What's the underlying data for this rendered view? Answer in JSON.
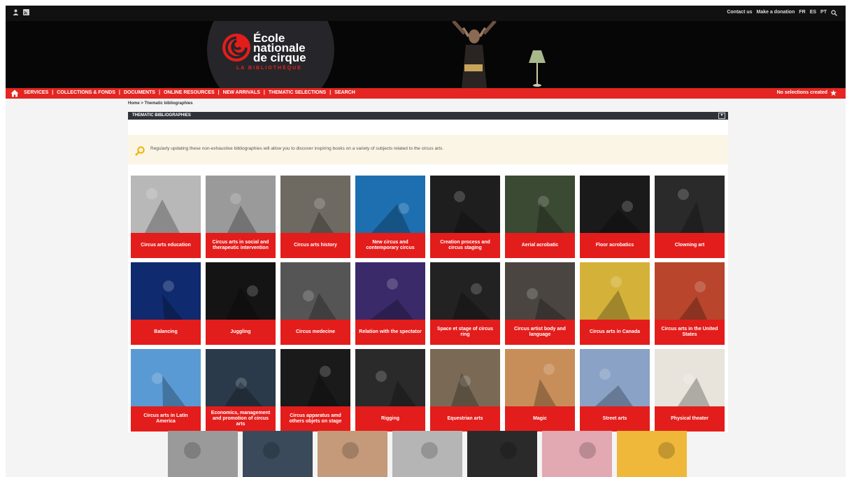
{
  "topbar": {
    "user_icon": "user-icon",
    "rss_icon": "rss-icon",
    "links": [
      "Contact us",
      "Make a donation",
      "FR",
      "ES",
      "PT"
    ],
    "search_icon": "search-icon"
  },
  "logo": {
    "line1": "École",
    "line2": "nationale",
    "line3": "de cirque",
    "sub": "LA BIBLIOTHÈQUE"
  },
  "nav": {
    "home_icon": "home-icon",
    "items": [
      "SERVICES",
      "COLLECTIONS & FONDS",
      "DOCUMENTS",
      "ONLINE RESOURCES",
      "NEW ARRIVALS",
      "THEMATIC SELECTIONS",
      "SEARCH"
    ],
    "selections": "No selections created",
    "star_icon": "star-icon"
  },
  "breadcrumb": {
    "home": "Home",
    "separator": ">",
    "current": "Thematic bibliographies"
  },
  "section": {
    "title": "THEMATIC BIBLIOGRAPHIES",
    "toggle_icon": "dropdown-toggle-icon"
  },
  "notice": {
    "text": "Regularly updating these non-exhaustive bibliographies will allow you to discover inspiring books on a variety of subjects related to the circus arts."
  },
  "colors": {
    "accent": "#e31d1b",
    "nav": "#e42521",
    "banner": "#060606",
    "section_bar": "#2f3339",
    "notice_bg": "#fbf5e6"
  },
  "cards": [
    {
      "label": "Circus arts education",
      "bg": "#b8b8b8"
    },
    {
      "label": "Circus arts in social and therapeutic intervention",
      "bg": "#9a9a9a"
    },
    {
      "label": "Circus arts history",
      "bg": "#6e6a62"
    },
    {
      "label": "New circus and contemporary circus",
      "bg": "#1d6fb0"
    },
    {
      "label": "Creation process and circus staging",
      "bg": "#1e1e1e"
    },
    {
      "label": "Aerial acrobatic",
      "bg": "#3b4a32"
    },
    {
      "label": "Floor acrobatics",
      "bg": "#1a1a1a"
    },
    {
      "label": "Clowning art",
      "bg": "#2a2a2a"
    },
    {
      "label": "Balancing",
      "bg": "#0f2a6e"
    },
    {
      "label": "Juggling",
      "bg": "#141414"
    },
    {
      "label": "Circus medecine",
      "bg": "#555555"
    },
    {
      "label": "Relation with the spectator",
      "bg": "#3a2a6a"
    },
    {
      "label": "Space et stage of circus ring",
      "bg": "#222222"
    },
    {
      "label": "Circus artist body and language",
      "bg": "#4a4540"
    },
    {
      "label": "Circus arts in Canada",
      "bg": "#d4b23a"
    },
    {
      "label": "Circus arts in the United States",
      "bg": "#b8452c"
    },
    {
      "label": "Circus arts in Latin America",
      "bg": "#5a9ad4"
    },
    {
      "label": "Economics, management and promotion of circus arts",
      "bg": "#2b3a4a"
    },
    {
      "label": "Circus apparatus amd others objets on stage",
      "bg": "#1a1a1a"
    },
    {
      "label": "Rigging",
      "bg": "#2a2a2a"
    },
    {
      "label": "Equestrian arts",
      "bg": "#7a6a55"
    },
    {
      "label": "Magic",
      "bg": "#c78e5a"
    },
    {
      "label": "Street arts",
      "bg": "#8aa2c6"
    },
    {
      "label": "Physical theater",
      "bg": "#e8e4dc"
    }
  ],
  "bottom_images": [
    {
      "bg": "#9a9a9a"
    },
    {
      "bg": "#3a4a5a"
    },
    {
      "bg": "#c49a7a"
    },
    {
      "bg": "#b5b5b5"
    },
    {
      "bg": "#2a2a2a"
    },
    {
      "bg": "#e2a9b2"
    },
    {
      "bg": "#f0b83a"
    }
  ]
}
